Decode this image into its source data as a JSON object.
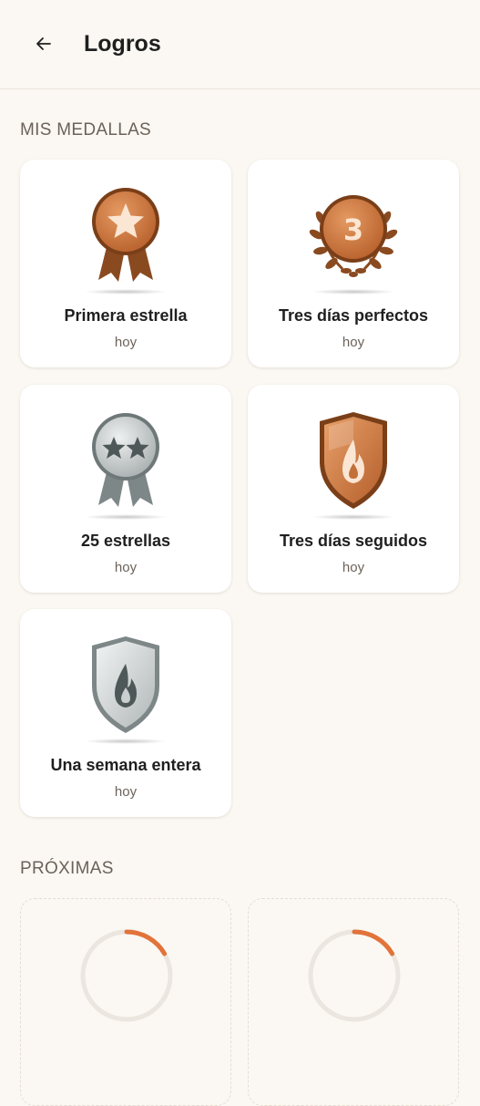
{
  "header": {
    "title": "Logros"
  },
  "sections": {
    "earned_title": "MIS MEDALLAS",
    "upcoming_title": "PRÓXIMAS"
  },
  "medals": [
    {
      "name": "Primera estrella",
      "date": "hoy",
      "icon": "bronze-star-ribbon-medal-icon"
    },
    {
      "name": "Tres días perfectos",
      "date": "hoy",
      "icon": "bronze-laurel-3-medal-icon"
    },
    {
      "name": "25 estrellas",
      "date": "hoy",
      "icon": "silver-two-stars-ribbon-medal-icon"
    },
    {
      "name": "Tres días seguidos",
      "date": "hoy",
      "icon": "bronze-flame-shield-icon"
    },
    {
      "name": "Una semana entera",
      "date": "hoy",
      "icon": "silver-flame-shield-icon"
    }
  ],
  "upcoming": [
    {
      "progress": 0.25
    },
    {
      "progress": 0.25
    }
  ],
  "colors": {
    "background": "#fbf8f3",
    "bronze": "#c26f3a",
    "silver": "#b9bfc0",
    "progress_accent": "#e2733a"
  }
}
